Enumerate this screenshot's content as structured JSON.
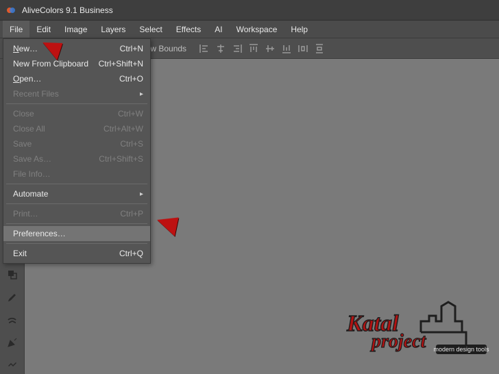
{
  "titlebar": {
    "title": "AliveColors 9.1 Business"
  },
  "menubar": {
    "items": [
      {
        "label": "File",
        "open": true
      },
      {
        "label": "Edit"
      },
      {
        "label": "Image"
      },
      {
        "label": "Layers"
      },
      {
        "label": "Select"
      },
      {
        "label": "Effects"
      },
      {
        "label": "AI"
      },
      {
        "label": "Workspace"
      },
      {
        "label": "Help"
      }
    ]
  },
  "toolbar": {
    "select1": "",
    "select2": "",
    "show_bounds_label": "Show Bounds",
    "show_bounds_checked": true
  },
  "file_menu": {
    "items": [
      {
        "label": "New…",
        "shortcut": "Ctrl+N",
        "underline_first": true
      },
      {
        "label": "New From Clipboard",
        "shortcut": "Ctrl+Shift+N"
      },
      {
        "label": "Open…",
        "shortcut": "Ctrl+O",
        "underline_first": true
      },
      {
        "label": "Recent Files",
        "disabled": true,
        "submenu": true
      },
      {
        "sep": true
      },
      {
        "label": "Close",
        "shortcut": "Ctrl+W",
        "disabled": true
      },
      {
        "label": "Close All",
        "shortcut": "Ctrl+Alt+W",
        "disabled": true
      },
      {
        "label": "Save",
        "shortcut": "Ctrl+S",
        "disabled": true
      },
      {
        "label": "Save As…",
        "shortcut": "Ctrl+Shift+S",
        "disabled": true
      },
      {
        "label": "File Info…",
        "disabled": true
      },
      {
        "sep": true
      },
      {
        "label": "Automate",
        "submenu": true
      },
      {
        "sep": true
      },
      {
        "label": "Print…",
        "shortcut": "Ctrl+P",
        "disabled": true
      },
      {
        "sep": true
      },
      {
        "label": "Preferences…",
        "highlight": true
      },
      {
        "sep": true
      },
      {
        "label": "Exit",
        "shortcut": "Ctrl+Q"
      }
    ]
  },
  "logo": {
    "line1": "Katal",
    "line2": "project",
    "tagline": "modern design tools"
  }
}
